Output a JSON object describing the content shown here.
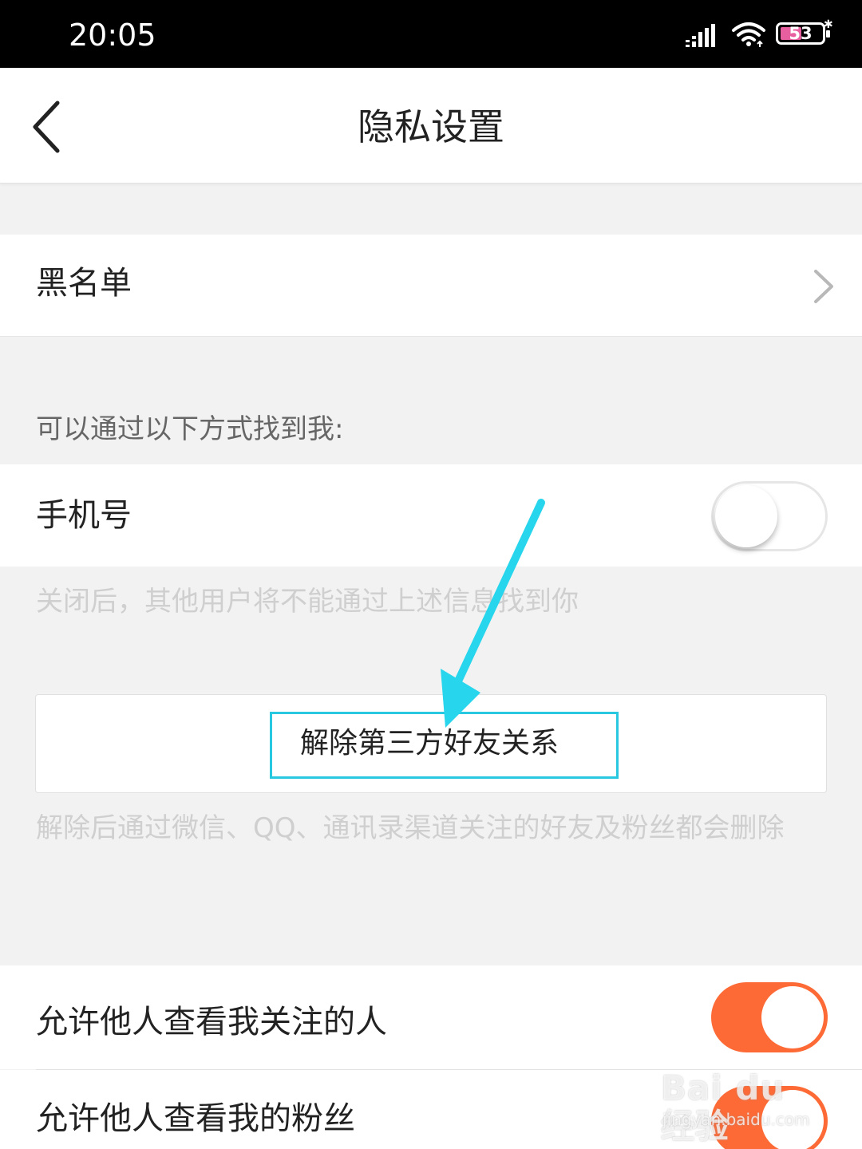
{
  "status_bar": {
    "time": "20:05",
    "battery_level": "53",
    "icons": [
      "signal-icon",
      "wifi-icon",
      "battery-icon",
      "charge-icon"
    ]
  },
  "nav": {
    "title": "隐私设置",
    "back_icon": "back-icon"
  },
  "blacklist": {
    "label": "黑名单",
    "icon": "chevron-right-icon"
  },
  "find_me": {
    "section_header": "可以通过以下方式找到我:",
    "phone_label": "手机号",
    "phone_toggle_on": false,
    "hint": "关闭后，其他用户将不能通过上述信息找到你"
  },
  "unbind": {
    "button_label": "解除第三方好友关系",
    "hint": "解除后通过微信、QQ、通讯录渠道关注的好友及粉丝都会删除"
  },
  "permissions": {
    "following_label": "允许他人查看我关注的人",
    "following_toggle_on": true,
    "fans_label": "允许他人查看我的粉丝",
    "fans_toggle_on": true
  },
  "watermark": {
    "brand": "Bai du 经验",
    "url": "jingyan.baidu.com"
  },
  "colors": {
    "accent": "#fd6a36",
    "highlight": "#27c8e0",
    "hint": "#cfcfcf",
    "background": "#f2f2f2"
  }
}
